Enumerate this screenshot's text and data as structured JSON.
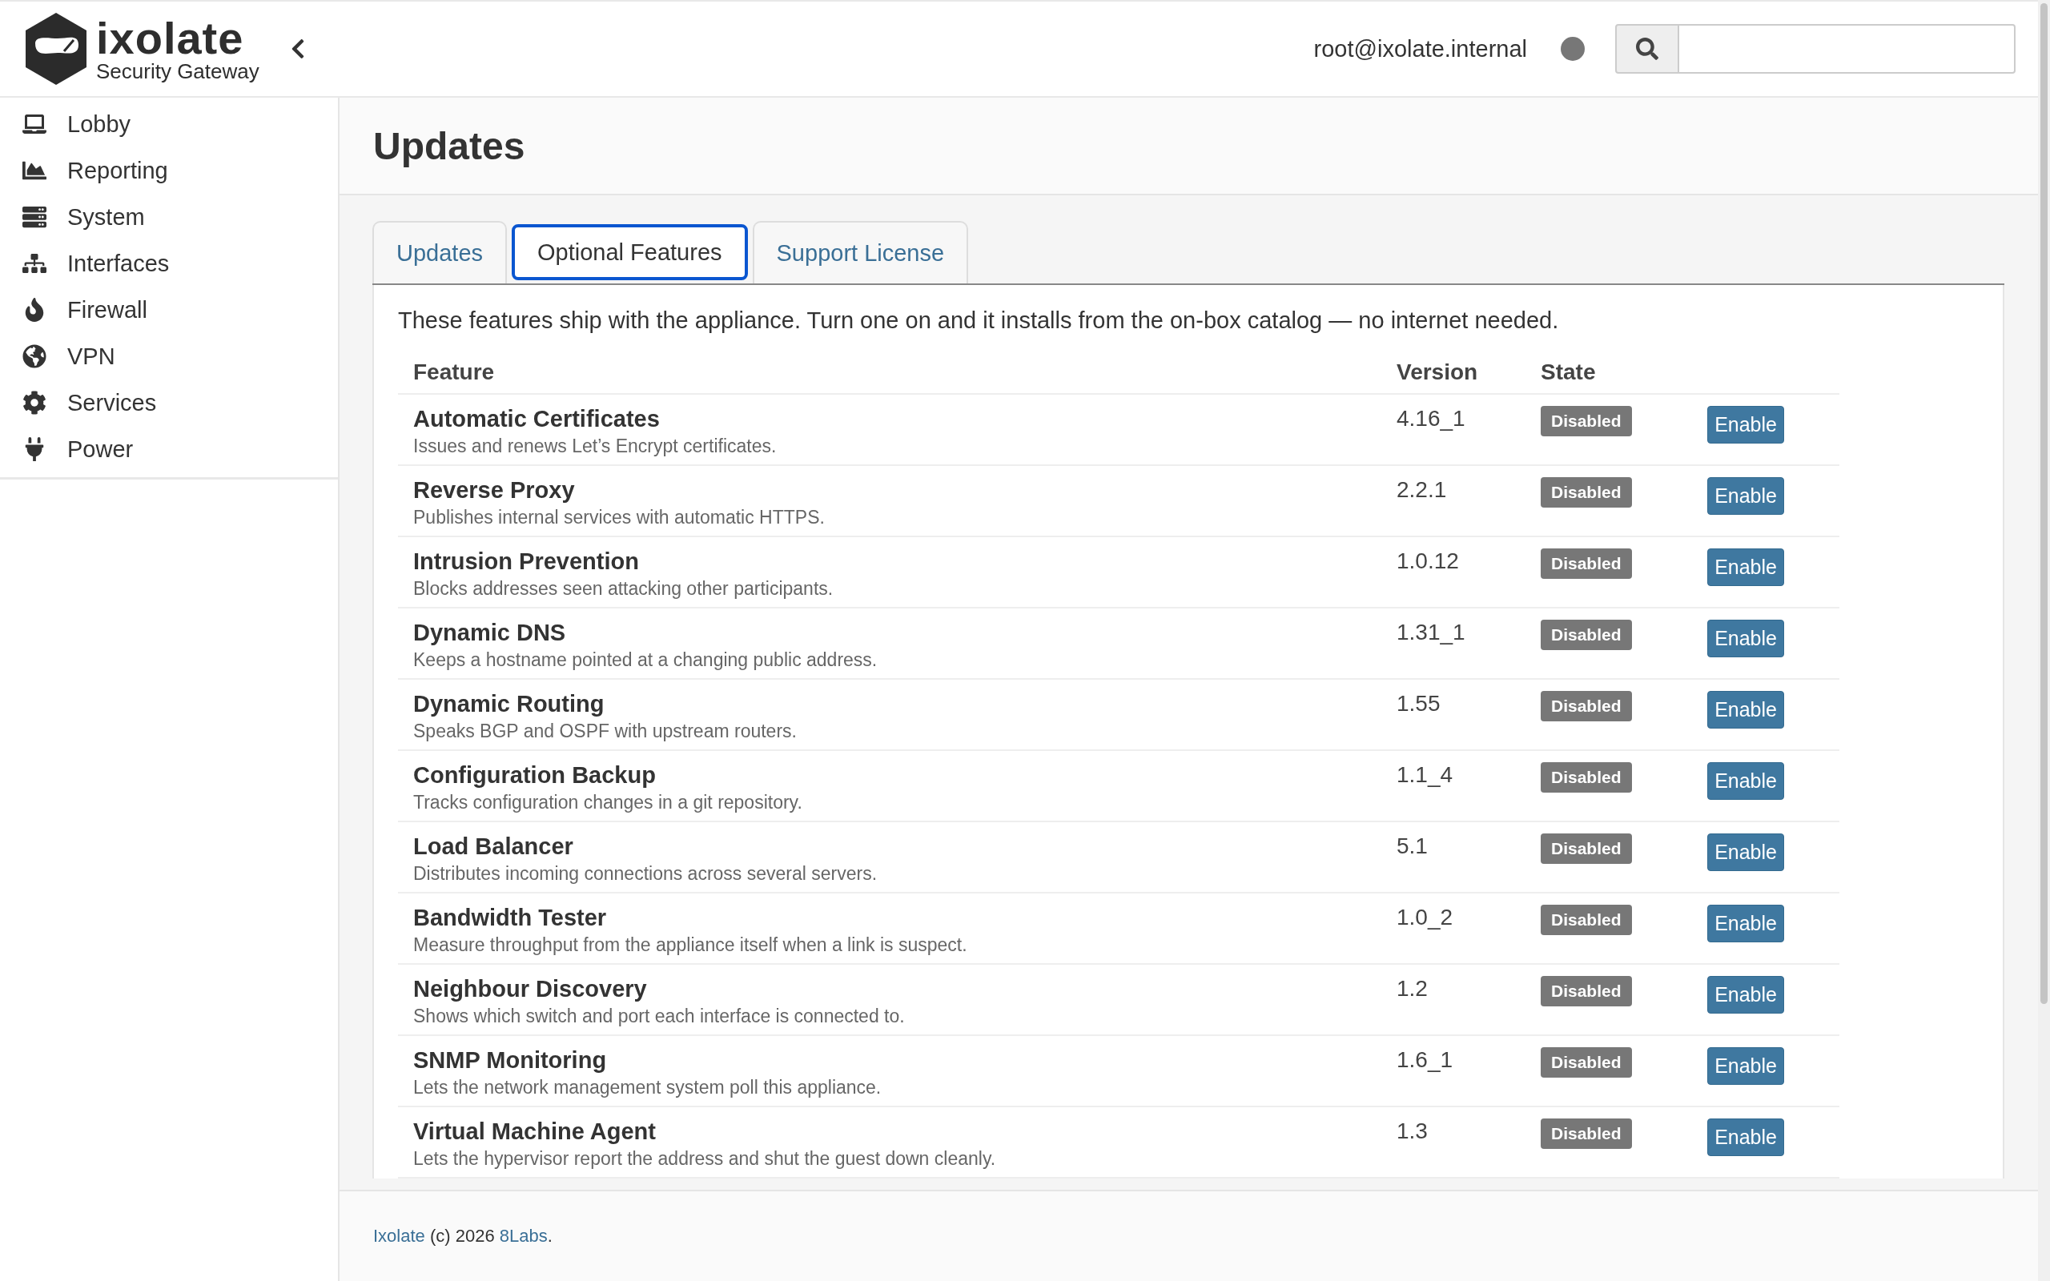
{
  "header": {
    "logo_name": "ixolate",
    "logo_subtitle": "Security Gateway",
    "user": "root@ixolate.internal"
  },
  "sidebar": {
    "items": [
      {
        "label": "Lobby"
      },
      {
        "label": "Reporting"
      },
      {
        "label": "System"
      },
      {
        "label": "Interfaces"
      },
      {
        "label": "Firewall"
      },
      {
        "label": "VPN"
      },
      {
        "label": "Services"
      },
      {
        "label": "Power"
      }
    ]
  },
  "page_title": "Updates",
  "tabs": [
    {
      "label": "Updates",
      "selected": false
    },
    {
      "label": "Optional Features",
      "selected": true
    },
    {
      "label": "Support License",
      "selected": false
    }
  ],
  "intro": "These features ship with the appliance. Turn one on and it installs from the on-box catalog — no internet needed.",
  "table": {
    "columns": [
      "Feature",
      "Version",
      "State"
    ],
    "rows": [
      {
        "name": "Automatic Certificates",
        "description": "Issues and renews Let’s Encrypt certificates.",
        "version": "4.16_1",
        "state": "Disabled",
        "action": "Enable"
      },
      {
        "name": "Reverse Proxy",
        "description": "Publishes internal services with automatic HTTPS.",
        "version": "2.2.1",
        "state": "Disabled",
        "action": "Enable"
      },
      {
        "name": "Intrusion Prevention",
        "description": "Blocks addresses seen attacking other participants.",
        "version": "1.0.12",
        "state": "Disabled",
        "action": "Enable"
      },
      {
        "name": "Dynamic DNS",
        "description": "Keeps a hostname pointed at a changing public address.",
        "version": "1.31_1",
        "state": "Disabled",
        "action": "Enable"
      },
      {
        "name": "Dynamic Routing",
        "description": "Speaks BGP and OSPF with upstream routers.",
        "version": "1.55",
        "state": "Disabled",
        "action": "Enable"
      },
      {
        "name": "Configuration Backup",
        "description": "Tracks configuration changes in a git repository.",
        "version": "1.1_4",
        "state": "Disabled",
        "action": "Enable"
      },
      {
        "name": "Load Balancer",
        "description": "Distributes incoming connections across several servers.",
        "version": "5.1",
        "state": "Disabled",
        "action": "Enable"
      },
      {
        "name": "Bandwidth Tester",
        "description": "Measure throughput from the appliance itself when a link is suspect.",
        "version": "1.0_2",
        "state": "Disabled",
        "action": "Enable"
      },
      {
        "name": "Neighbour Discovery",
        "description": "Shows which switch and port each interface is connected to.",
        "version": "1.2",
        "state": "Disabled",
        "action": "Enable"
      },
      {
        "name": "SNMP Monitoring",
        "description": "Lets the network management system poll this appliance.",
        "version": "1.6_1",
        "state": "Disabled",
        "action": "Enable"
      },
      {
        "name": "Virtual Machine Agent",
        "description": "Lets the hypervisor report the address and shut the guest down cleanly.",
        "version": "1.3",
        "state": "Disabled",
        "action": "Enable"
      }
    ]
  },
  "footer": {
    "brand_link": "Ixolate",
    "text": "(c) 2026",
    "company_link": "8Labs",
    "end": "."
  }
}
